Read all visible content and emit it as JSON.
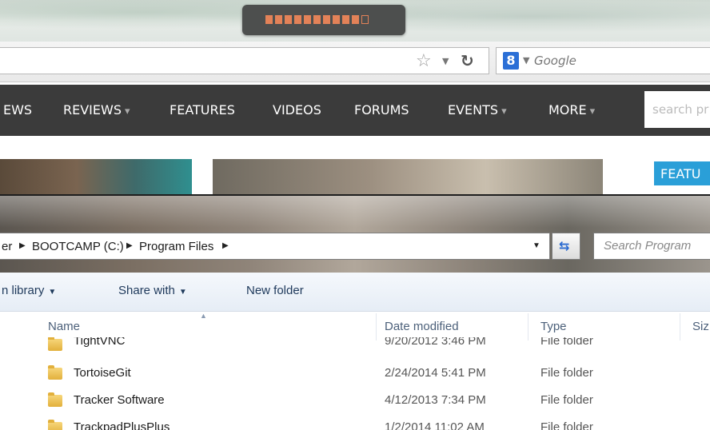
{
  "browser": {
    "search_engine": "Google"
  },
  "site_nav": {
    "items": [
      {
        "label": "EWS",
        "caret": ""
      },
      {
        "label": "REVIEWS",
        "caret": "▾"
      },
      {
        "label": "FEATURES",
        "caret": ""
      },
      {
        "label": "VIDEOS",
        "caret": ""
      },
      {
        "label": "FORUMS",
        "caret": ""
      },
      {
        "label": "EVENTS",
        "caret": "▾"
      },
      {
        "label": "MORE",
        "caret": "▾"
      }
    ],
    "search_placeholder": "search pr"
  },
  "page": {
    "featured_label": "FEATU"
  },
  "explorer": {
    "breadcrumbs": [
      "er",
      "BOOTCAMP (C:)",
      "Program Files"
    ],
    "search_placeholder": "Search Program",
    "commands": {
      "library": "n library",
      "share": "Share with",
      "new_folder": "New folder"
    },
    "columns": {
      "name": "Name",
      "date": "Date modified",
      "type": "Type",
      "size": "Siz"
    },
    "rows": [
      {
        "name": "TightVNC",
        "date": "9/20/2012 3:46 PM",
        "type": "File folder"
      },
      {
        "name": "TortoiseGit",
        "date": "2/24/2014 5:41 PM",
        "type": "File folder"
      },
      {
        "name": "Tracker Software",
        "date": "4/12/2013 7:34 PM",
        "type": "File folder"
      },
      {
        "name": "TrackpadPlusPlus",
        "date": "1/2/2014 11:02 AM",
        "type": "File folder"
      }
    ]
  }
}
